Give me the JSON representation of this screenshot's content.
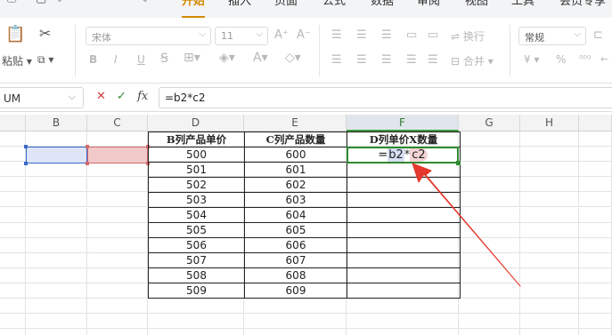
{
  "menu": {
    "tabs": [
      "开始",
      "插入",
      "页面",
      "公式",
      "数据",
      "审阅",
      "视图",
      "工具",
      "会员专享"
    ],
    "active_tab": "开始"
  },
  "ribbon": {
    "paste_label": "粘贴",
    "font_name": "宋体",
    "font_size": "11",
    "wrap_label": "换行",
    "merge_label": "合并",
    "number_format": "常规",
    "font_style_buttons": [
      "B",
      "I",
      "U"
    ],
    "currency_symbol": "¥",
    "percent_symbol": "%"
  },
  "formula_bar": {
    "name_box": "UM",
    "cancel_symbol": "✕",
    "confirm_symbol": "✓",
    "fx_label": "fx",
    "formula": "=b2*c2"
  },
  "columns": [
    "B",
    "C",
    "D",
    "E",
    "F",
    "G",
    "H"
  ],
  "selected_column": "F",
  "table": {
    "headers": [
      "B列产品单价",
      "C列产品数量",
      "D列单价X数量"
    ],
    "rows": [
      [
        "500",
        "600",
        "=b2*c2"
      ],
      [
        "501",
        "601",
        ""
      ],
      [
        "502",
        "602",
        ""
      ],
      [
        "503",
        "603",
        ""
      ],
      [
        "504",
        "604",
        ""
      ],
      [
        "505",
        "605",
        ""
      ],
      [
        "506",
        "606",
        ""
      ],
      [
        "507",
        "607",
        ""
      ],
      [
        "508",
        "608",
        ""
      ],
      [
        "509",
        "609",
        ""
      ]
    ]
  },
  "formula_cell": {
    "eq": "=",
    "ref1": "b2",
    "op": "*",
    "ref2": "c2"
  },
  "colors": {
    "accent": "#d38a00",
    "selection_green": "#2f8a2f",
    "ref_blue": "#3a66c8",
    "ref_red": "#d46a6a",
    "arrow_red": "#e5372b"
  }
}
